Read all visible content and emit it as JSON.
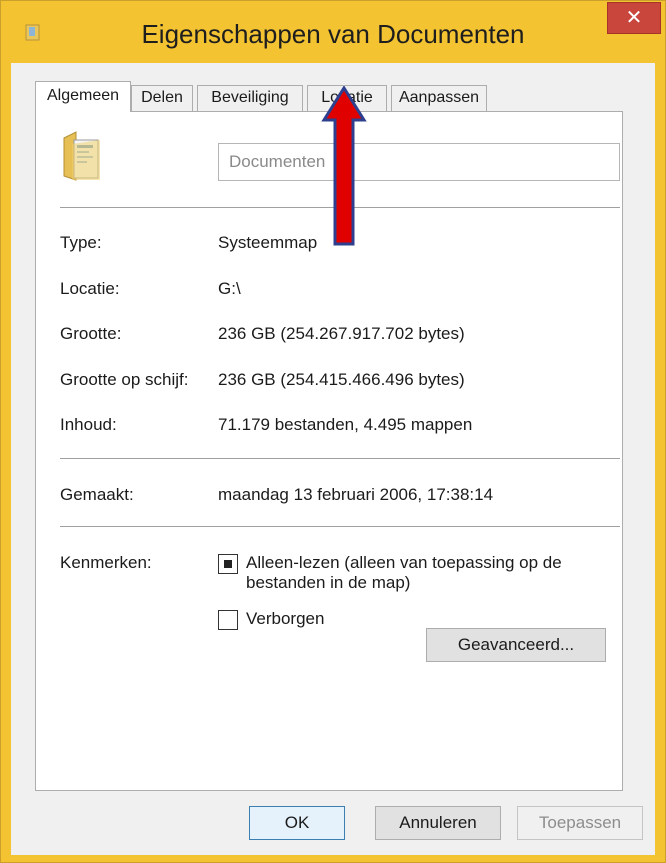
{
  "window": {
    "title": "Eigenschappen van Documenten",
    "close_glyph": "✕",
    "icon": "folder-small-icon"
  },
  "tabs": [
    {
      "label": "Algemeen",
      "active": true
    },
    {
      "label": "Delen",
      "active": false
    },
    {
      "label": "Beveiliging",
      "active": false
    },
    {
      "label": "Locatie",
      "active": false
    },
    {
      "label": "Aanpassen",
      "active": false
    }
  ],
  "general": {
    "folder_icon": "documents-folder-icon",
    "name_value": "Documenten",
    "properties": [
      {
        "label": "Type:",
        "value": "Systeemmap"
      },
      {
        "label": "Locatie:",
        "value": "G:\\"
      },
      {
        "label": "Grootte:",
        "value": "236 GB (254.267.917.702 bytes)"
      },
      {
        "label": "Grootte op schijf:",
        "value": "236 GB (254.415.466.496 bytes)"
      },
      {
        "label": "Inhoud:",
        "value": "71.179 bestanden, 4.495 mappen"
      }
    ],
    "created": {
      "label": "Gemaakt:",
      "value": "maandag 13 februari 2006, 17:38:14"
    },
    "attributes": {
      "label": "Kenmerken:",
      "readonly_line1": "Alleen-lezen (alleen van toepassing op de",
      "readonly_line2": "bestanden in de map)",
      "readonly_state": "indeterminate",
      "hidden_label": "Verborgen",
      "hidden_checked": false,
      "advanced_button": "Geavanceerd..."
    }
  },
  "buttons": {
    "ok": "OK",
    "cancel": "Annuleren",
    "apply": "Toepassen"
  },
  "annotation": {
    "arrow_color": "#e00000",
    "arrow_outline": "#2f3f8f",
    "points_to": "Locatie"
  }
}
